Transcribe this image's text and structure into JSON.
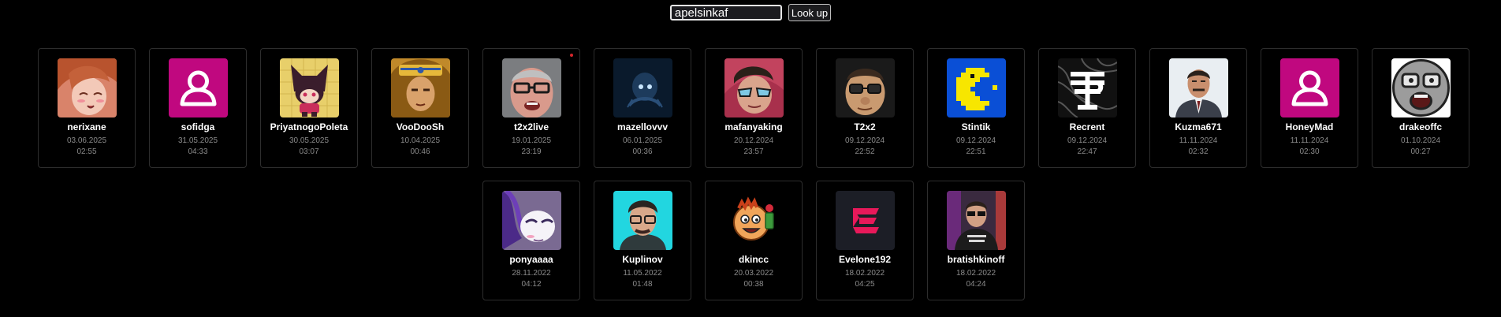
{
  "search": {
    "value": "apelsinkaf",
    "button_label": "Look up"
  },
  "rows": [
    [
      {
        "name": "nerixane",
        "date": "03.06.2025",
        "time": "02:55",
        "icon": "anime-girl-avatar"
      },
      {
        "name": "sofidga",
        "date": "31.05.2025",
        "time": "04:33",
        "icon": "default-user-avatar"
      },
      {
        "name": "PriyatnogoPoleta",
        "date": "30.05.2025",
        "time": "03:07",
        "icon": "cat-hood-character-avatar"
      },
      {
        "name": "VooDooSh",
        "date": "10.04.2025",
        "time": "00:46",
        "icon": "pharaoh-avatar"
      },
      {
        "name": "t2x2live",
        "date": "19.01.2025",
        "time": "23:19",
        "icon": "man-glasses-avatar",
        "live": true
      },
      {
        "name": "mazellovvv",
        "date": "06.01.2025",
        "time": "00:36",
        "icon": "dark-creature-avatar"
      },
      {
        "name": "mafanyaking",
        "date": "20.12.2024",
        "time": "23:57",
        "icon": "person-sunglasses-avatar"
      },
      {
        "name": "T2x2",
        "date": "09.12.2024",
        "time": "22:52",
        "icon": "cartoon-man-avatar"
      },
      {
        "name": "Stintik",
        "date": "09.12.2024",
        "time": "22:51",
        "icon": "pacman-avatar"
      },
      {
        "name": "Recrent",
        "date": "09.12.2024",
        "time": "22:47",
        "icon": "recrent-logo-avatar"
      },
      {
        "name": "Kuzma671",
        "date": "11.11.2024",
        "time": "02:32",
        "icon": "man-suit-avatar"
      },
      {
        "name": "HoneyMad",
        "date": "11.11.2024",
        "time": "02:30",
        "icon": "default-user-avatar"
      },
      {
        "name": "drakeoffc",
        "date": "01.10.2024",
        "time": "00:27",
        "icon": "screaming-face-avatar"
      }
    ],
    [
      {
        "name": "ponyaaaa",
        "date": "28.11.2022",
        "time": "04:12",
        "icon": "pony-avatar"
      },
      {
        "name": "Kuplinov",
        "date": "11.05.2022",
        "time": "01:48",
        "icon": "man-cyan-background-avatar"
      },
      {
        "name": "dkincc",
        "date": "20.03.2022",
        "time": "00:38",
        "icon": "cartoon-orange-face-avatar"
      },
      {
        "name": "Evelone192",
        "date": "18.02.2022",
        "time": "04:25",
        "icon": "evelone-logo-avatar"
      },
      {
        "name": "bratishkinoff",
        "date": "18.02.2022",
        "time": "04:24",
        "icon": "streamer-room-avatar"
      }
    ]
  ],
  "colors": {
    "background": "#000000",
    "card_border": "#2d2d2d",
    "default_avatar": "#c0087f",
    "pacman_bg": "#0a4fd6",
    "pacman_yellow": "#f7e600",
    "evelone_pink": "#e8195a",
    "live_dot": "#d4262b"
  }
}
